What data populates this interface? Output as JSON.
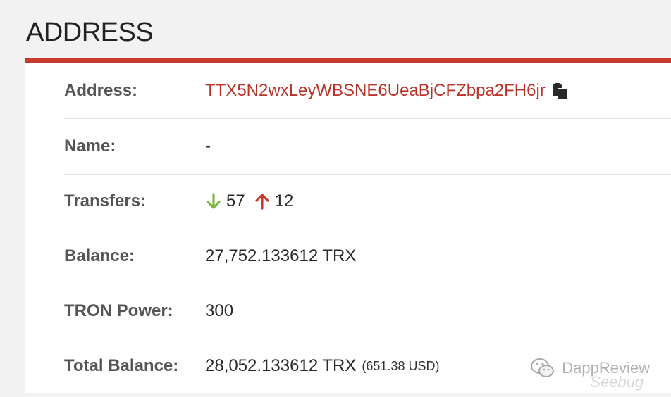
{
  "page": {
    "heading": "ADDRESS"
  },
  "colors": {
    "accent": "#c53a2b",
    "address_link": "#b83328",
    "incoming_arrow": "#7cb342",
    "outgoing_arrow": "#c53a2b"
  },
  "rows": {
    "address": {
      "label": "Address:",
      "value": "TTX5N2wxLeyWBSNE6UeaBjCFZbpa2FH6jr",
      "icon": "copy-icon"
    },
    "name": {
      "label": "Name:",
      "value": "-"
    },
    "transfers": {
      "label": "Transfers:",
      "incoming_icon": "arrow-down-icon",
      "incoming_count": "57",
      "outgoing_icon": "arrow-up-icon",
      "outgoing_count": "12"
    },
    "balance": {
      "label": "Balance:",
      "value": "27,752.133612 TRX"
    },
    "tron_power": {
      "label": "TRON Power:",
      "value": "300"
    },
    "total_balance": {
      "label": "Total Balance:",
      "value": "28,052.133612 TRX",
      "usd": "(651.38 USD)"
    }
  },
  "watermark": {
    "text": "DappReview",
    "subtext": "Seebug",
    "icon": "wechat-icon"
  }
}
